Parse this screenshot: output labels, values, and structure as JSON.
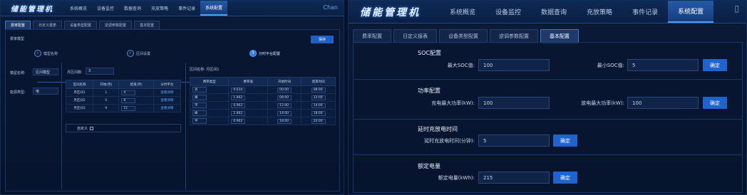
{
  "left": {
    "brand": "储能管理机",
    "nav": [
      "系统概览",
      "设备监控",
      "数据查询",
      "充放策略",
      "事件记录",
      "系统配置"
    ],
    "nav_active": 5,
    "top_right": "Chan",
    "tabs": [
      "费率配置",
      "日定义报表",
      "设备类型配置",
      "逆调参数配置",
      "基本配置"
    ],
    "tab_active": 0,
    "section_title": "费率模型",
    "save_button": "保存",
    "steps": [
      {
        "num": "✓",
        "label": "模型名称"
      },
      {
        "num": "✓",
        "label": "区间设置"
      },
      {
        "num": "3",
        "label": "分时平台配置"
      }
    ],
    "model_name_label": "模型名称:",
    "model_name_value": "区间模型",
    "power_type_label": "能源类型:",
    "power_type_value": "电",
    "month_count_label": "月区间数:",
    "month_count_value": "3",
    "month_table": {
      "headers": [
        "区间名称",
        "开始(月)",
        "结束(月)",
        "分时平台"
      ],
      "rows": [
        {
          "name": "月区间1",
          "start": "1",
          "end": "4",
          "action": "查看详情"
        },
        {
          "name": "月区间2",
          "start": "5",
          "end": "8",
          "action": "查看详情"
        },
        {
          "name": "月区间3",
          "start": "9",
          "end": "11",
          "action": "查看详情"
        }
      ]
    },
    "custom_label": "自定义",
    "period_label": "区间名称: 月区间1",
    "rate_table": {
      "headers": [
        "费率类型",
        "费率值",
        "开始时间",
        "结束时间"
      ],
      "rows": [
        {
          "type": "谷",
          "value": "0.634",
          "start": "00:00",
          "end": "08:00"
        },
        {
          "type": "峰",
          "value": "1.862",
          "start": "08:00",
          "end": "12:00"
        },
        {
          "type": "平",
          "value": "0.962",
          "start": "12:00",
          "end": "14:00"
        },
        {
          "type": "峰",
          "value": "1.862",
          "start": "14:00",
          "end": "18:00"
        },
        {
          "type": "平",
          "value": "0.962",
          "start": "18:00",
          "end": "24:00"
        }
      ]
    }
  },
  "right": {
    "brand": "储能管理机",
    "nav": [
      "系统概览",
      "设备监控",
      "数据查询",
      "充放策略",
      "事件记录",
      "系统配置"
    ],
    "nav_active": 5,
    "top_icon": "bell-icon",
    "tabs": [
      "费率配置",
      "日定义报表",
      "设备类型配置",
      "逆调参数配置",
      "基本配置"
    ],
    "tab_active": 4,
    "soc": {
      "title": "SOC配置",
      "max_label": "最大SOC值:",
      "max_value": "100",
      "min_label": "最小SOC值:",
      "min_value": "5",
      "confirm": "确定"
    },
    "power": {
      "title": "功率配置",
      "charge_label": "充电最大功率(kW):",
      "charge_value": "100",
      "discharge_label": "放电最大功率(kW):",
      "discharge_value": "100",
      "confirm": "确定"
    },
    "delay": {
      "title": "延时充放电时间",
      "label": "延时充放电时间(分钟):",
      "value": "5",
      "confirm": "确定"
    },
    "capacity": {
      "title": "额定电量",
      "label": "额定电量(kWh):",
      "value": "215",
      "confirm": "确定"
    }
  }
}
